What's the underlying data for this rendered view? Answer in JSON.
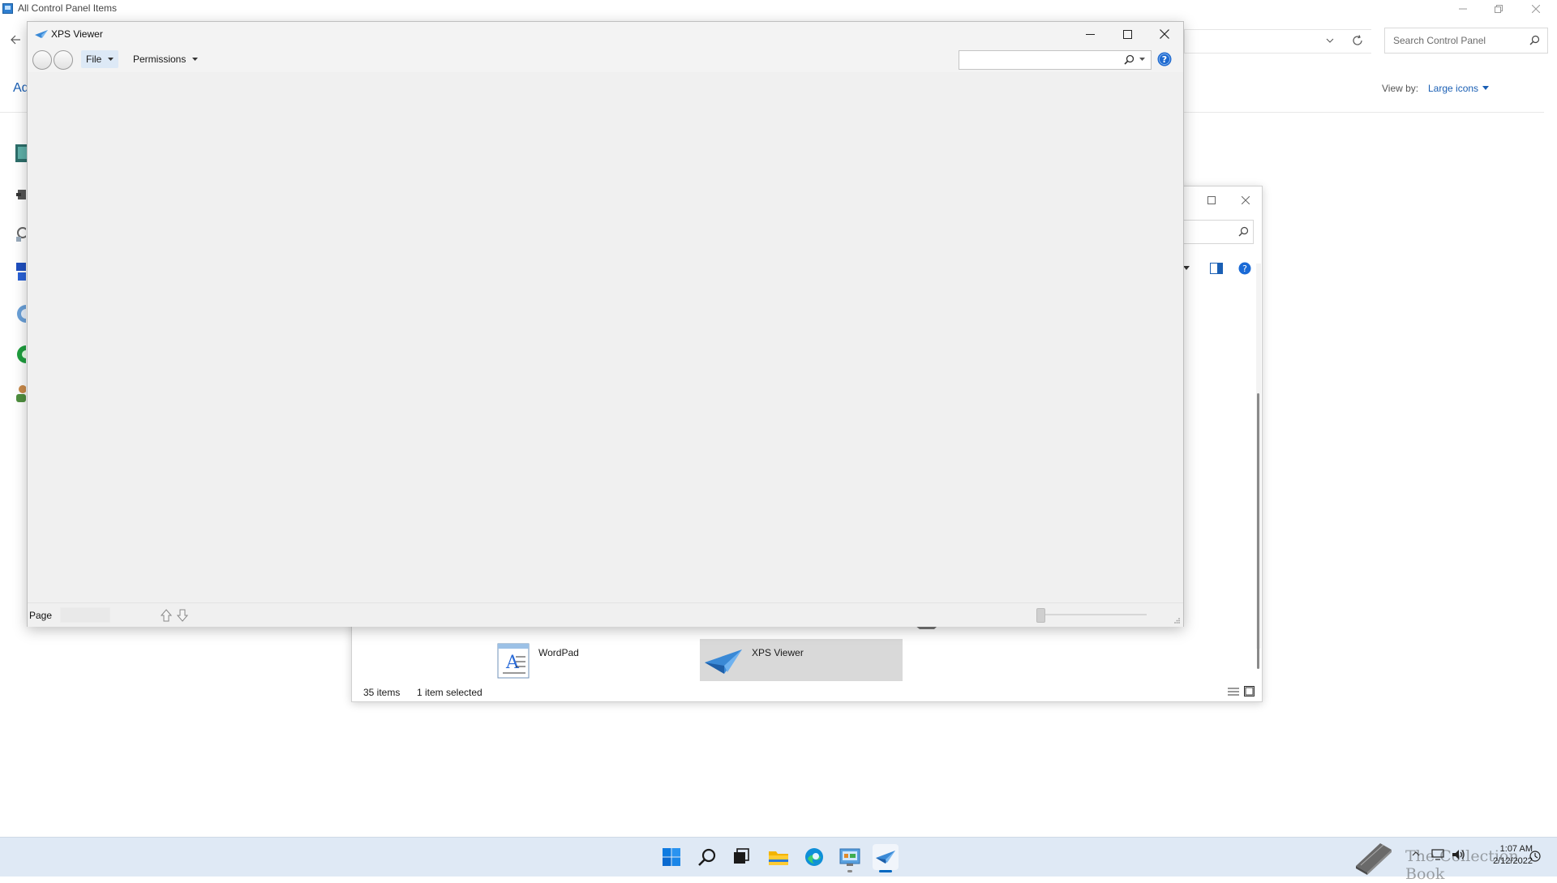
{
  "control_panel": {
    "title": "All Control Panel Items",
    "search_placeholder": "Search Control Panel",
    "view_by_label": "View by:",
    "view_by_value": "Large icons",
    "header_fragment": "Ad"
  },
  "programs_window": {
    "items": [
      {
        "label": "WordPad",
        "icon": "wordpad-icon"
      },
      {
        "label": "XPS Viewer",
        "icon": "xps-viewer-icon",
        "selected": true
      }
    ],
    "status": {
      "count": "35 items",
      "selection": "1 item selected"
    }
  },
  "xps_viewer": {
    "title": "XPS Viewer",
    "menus": {
      "file": "File",
      "permissions": "Permissions"
    },
    "find_value": "",
    "status": {
      "page_label": "Page",
      "page_value": ""
    },
    "zoom_level": 0
  },
  "taskbar": {
    "icons": [
      "start-icon",
      "search-icon",
      "task-view-icon",
      "file-explorer-icon",
      "edge-icon",
      "control-panel-icon",
      "xps-viewer-icon"
    ],
    "clock": {
      "time": "1:07 AM",
      "date": "2/12/2022"
    },
    "watermark_text": "The Collection Book"
  },
  "colors": {
    "accent": "#0067c0",
    "selection": "#d9d9d9",
    "taskbar": "#dfe9f5"
  }
}
